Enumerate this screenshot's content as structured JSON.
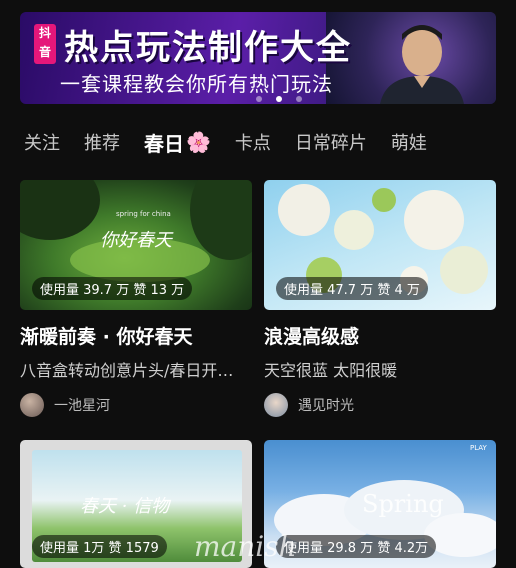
{
  "banner": {
    "badge": "抖音",
    "title": "热点玩法制作大全",
    "subtitle": "一套课程教会你所有热门玩法",
    "dots": 3,
    "active_dot": 1
  },
  "tabs": [
    {
      "label": "关注"
    },
    {
      "label": "推荐"
    },
    {
      "label": "春日",
      "emoji": "🌸",
      "active": true
    },
    {
      "label": "卡点"
    },
    {
      "label": "日常碎片"
    },
    {
      "label": "萌娃"
    }
  ],
  "cards": [
    {
      "stats": "使用量 39.7 万 赞 13 万",
      "overlay_text": "你好春天",
      "overlay_small": "spring for china",
      "title": "渐暖前奏 · 你好春天",
      "desc": "八音盒转动创意片头/春日开…",
      "author": "一池星河"
    },
    {
      "stats": "使用量 47.7 万 赞 4 万",
      "title": "浪漫高级感",
      "desc": "天空很蓝 太阳很暖",
      "author": "遇见时光"
    },
    {
      "stats": "使用量 1万 赞 1579",
      "overlay_text": "春天 · 信物",
      "title": "",
      "desc": "",
      "author": ""
    },
    {
      "stats": "使用量 29.8 万 赞 4.2万",
      "overlay_text": "Spring",
      "overlay_play": "PLAY",
      "title": "",
      "desc": "",
      "author": ""
    }
  ],
  "watermark": "manish",
  "colors": {
    "accent": "#fe2c55",
    "background": "#0e0e0e"
  }
}
